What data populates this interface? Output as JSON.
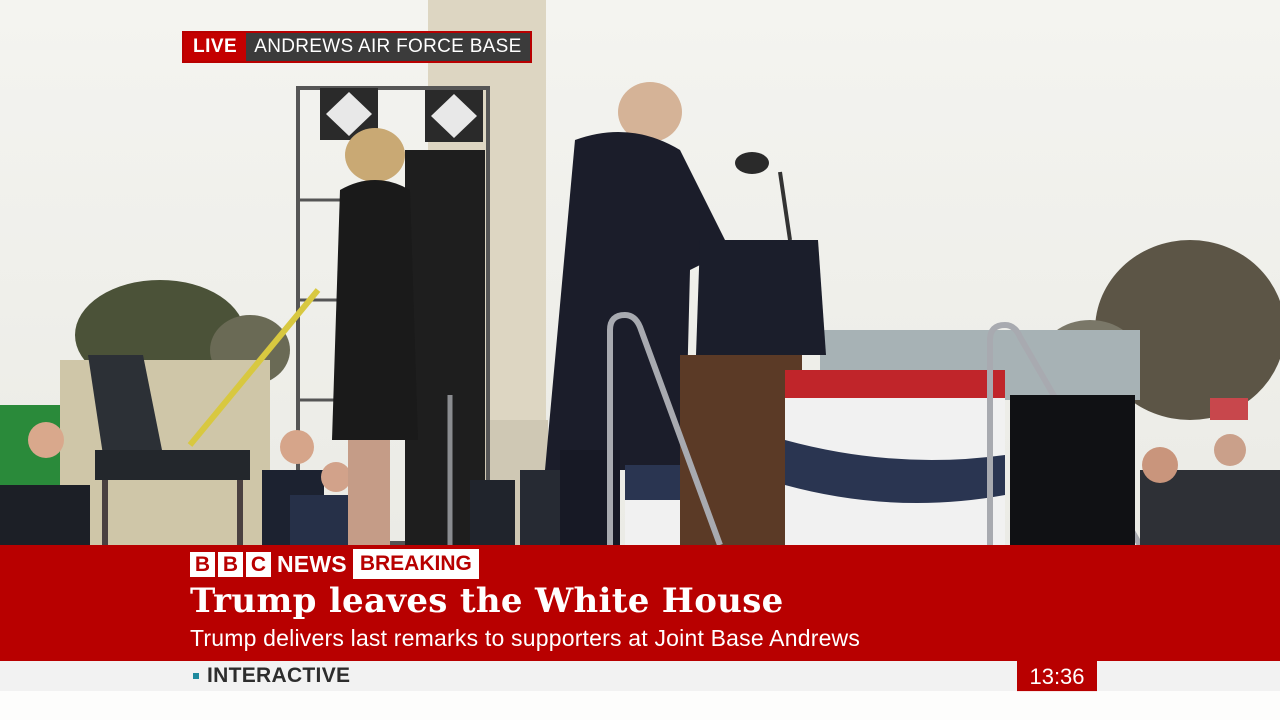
{
  "live_tag": {
    "live": "LIVE",
    "location": "ANDREWS AIR FORCE BASE"
  },
  "lower_third": {
    "brand_letters": [
      "B",
      "B",
      "C"
    ],
    "news": "NEWS",
    "breaking": "BREAKING",
    "headline": "Trump leaves the White House",
    "subline": "Trump delivers last remarks to supporters at Joint Base Andrews"
  },
  "ticker": {
    "label": "INTERACTIVE"
  },
  "clock": "13:36",
  "colors": {
    "bbc_red": "#b80000",
    "ticker_accent": "#1f8a9e"
  }
}
